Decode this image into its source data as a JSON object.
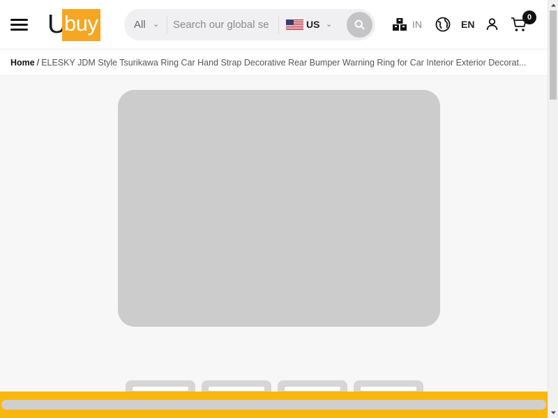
{
  "header": {
    "logo": {
      "letter": "U",
      "brand_tail": "buy",
      "box_color": "#f5a623"
    },
    "search": {
      "category": "All",
      "placeholder": "Search our global se",
      "store": "US",
      "flag": "us-flag-icon"
    },
    "shipping_label": "IN",
    "language_label": "EN",
    "cart_count": "0"
  },
  "breadcrumb": {
    "home": "Home",
    "separator": "/",
    "current": "ELESKY JDM Style Tsurikawa Ring Car Hand Strap Decorative Rear Bumper Warning Ring for Car Interior Exterior Decorat..."
  },
  "colors": {
    "accent": "#f8b70f",
    "logo": "#f5a623",
    "placeholder": "#cccccc"
  },
  "icons": {
    "menu": "hamburger-menu-icon",
    "search": "search-icon",
    "shipping": "shipping-icon",
    "globe": "globe-icon",
    "user": "user-icon",
    "cart": "cart-icon"
  }
}
